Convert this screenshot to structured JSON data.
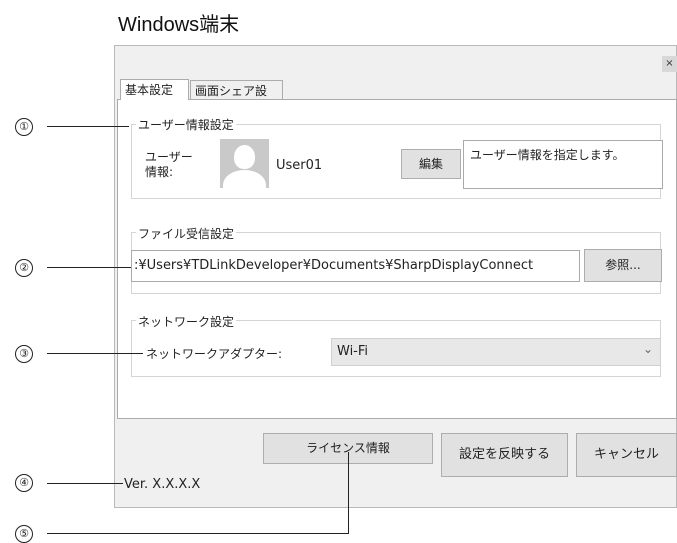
{
  "heading": "Windows端末",
  "dialog": {
    "close_glyph": "×",
    "tabs": [
      {
        "label": "基本設定",
        "active": true
      },
      {
        "label": "画面シェア設定",
        "active": false
      }
    ],
    "user_group": {
      "title": "ユーザー情報設定",
      "label_line1": "ユーザー",
      "label_line2": "情報:",
      "user_name": "User01",
      "edit_button": "編集",
      "description": "ユーザー情報を指定します。"
    },
    "file_group": {
      "title": "ファイル受信設定",
      "path_value": ":¥Users¥TDLinkDeveloper¥Documents¥SharpDisplayConnect",
      "browse_button": "参照..."
    },
    "network_group": {
      "title": "ネットワーク設定",
      "adapter_label": "ネットワークアダプター:",
      "adapter_selected": "Wi-Fi",
      "chevron": "⌄"
    },
    "license_button": "ライセンス情報",
    "apply_button": "設定を反映する",
    "cancel_button": "キャンセル",
    "version": "Ver. X.X.X.X"
  },
  "callouts": [
    "①",
    "②",
    "③",
    "④",
    "⑤"
  ]
}
